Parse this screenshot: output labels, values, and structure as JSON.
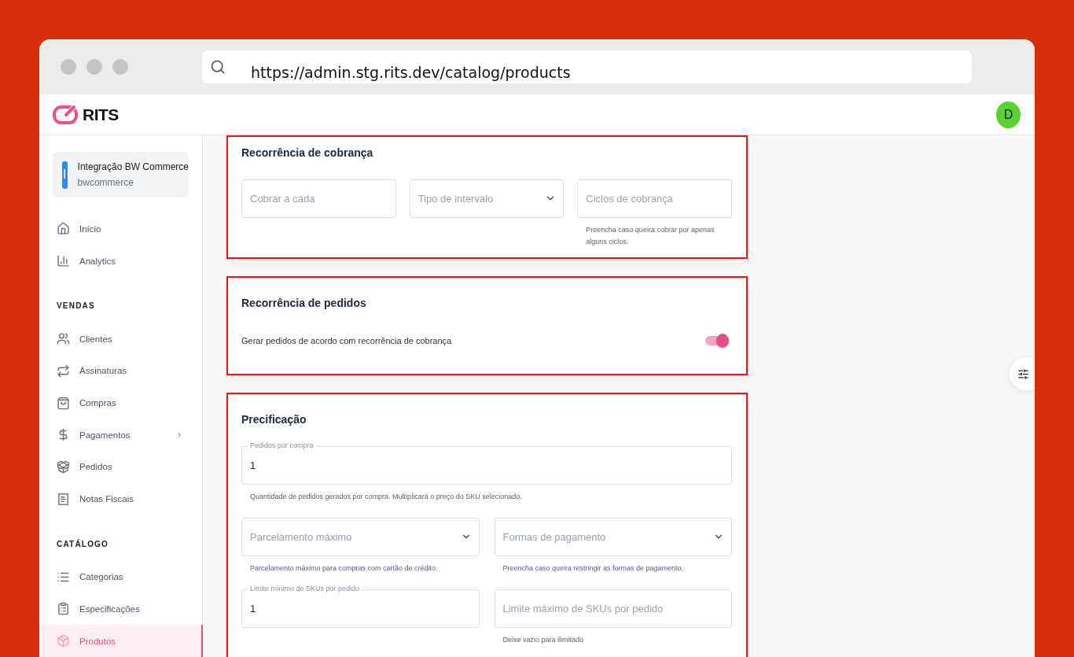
{
  "browser": {
    "url": "https://admin.stg.rits.dev/catalog/products"
  },
  "header": {
    "logo_text": "RITS",
    "avatar": "D"
  },
  "sidebar": {
    "workspace": {
      "initial": "I",
      "name": "Integração BW Commerce",
      "slug": "bwcommerce"
    },
    "sections": [
      {
        "items": [
          {
            "label": "Início",
            "selected": false,
            "has_submenu": false
          },
          {
            "label": "Analytics",
            "selected": false,
            "has_submenu": false
          }
        ]
      },
      {
        "heading": "VENDAS",
        "items": [
          {
            "label": "Clientes",
            "selected": false,
            "has_submenu": false
          },
          {
            "label": "Assinaturas",
            "selected": false,
            "has_submenu": false
          },
          {
            "label": "Compras",
            "selected": false,
            "has_submenu": false
          },
          {
            "label": "Pagamentos",
            "selected": false,
            "has_submenu": true
          },
          {
            "label": "Pedidos",
            "selected": false,
            "has_submenu": false
          },
          {
            "label": "Notas Fiscais",
            "selected": false,
            "has_submenu": false
          }
        ]
      },
      {
        "heading": "CATÁLOGO",
        "items": [
          {
            "label": "Categorias",
            "selected": false,
            "has_submenu": false
          },
          {
            "label": "Especificações",
            "selected": false,
            "has_submenu": false
          },
          {
            "label": "Produtos",
            "selected": true,
            "has_submenu": false
          }
        ]
      }
    ]
  },
  "cards": [
    {
      "title": "Recorrência de cobrança",
      "kind": "field_row",
      "fields": [
        {
          "kind": "text",
          "placeholder": "Cobrar a cada"
        },
        {
          "kind": "select",
          "placeholder": "Tipo de intervalo"
        },
        {
          "kind": "text",
          "placeholder": "Ciclos de cobrança",
          "helper": "Preencha caso queira cobrar por apenas alguns ciclos."
        }
      ]
    },
    {
      "title": "Recorrência de pedidos",
      "kind": "toggle",
      "label": "Gerar pedidos de acordo com recorrência de cobrança",
      "on": true
    },
    {
      "title": "Precificação",
      "kind": "field_grid",
      "fields": [
        {
          "kind": "text",
          "label": "Pedidos por compra",
          "value": "1",
          "wide": true,
          "helper": "Quantidade de pedidos gerados por compra. Multiplicará o preço do SKU selecionado."
        },
        {
          "kind": "select",
          "placeholder": "Parcelamento máximo",
          "helper": "Parcelamento máximo para compras com cartão de crédito."
        },
        {
          "kind": "select",
          "placeholder": "Formas de pagamento",
          "helper": "Preencha caso queira restringir as formas de pagamento."
        },
        {
          "kind": "text",
          "label": "Limite mínimo de SKUs por pedido",
          "value": "1"
        },
        {
          "kind": "text",
          "placeholder": "Limite máximo de SKUs por pedido",
          "helper": "Deixe vazio para ilimitado"
        }
      ]
    }
  ]
}
